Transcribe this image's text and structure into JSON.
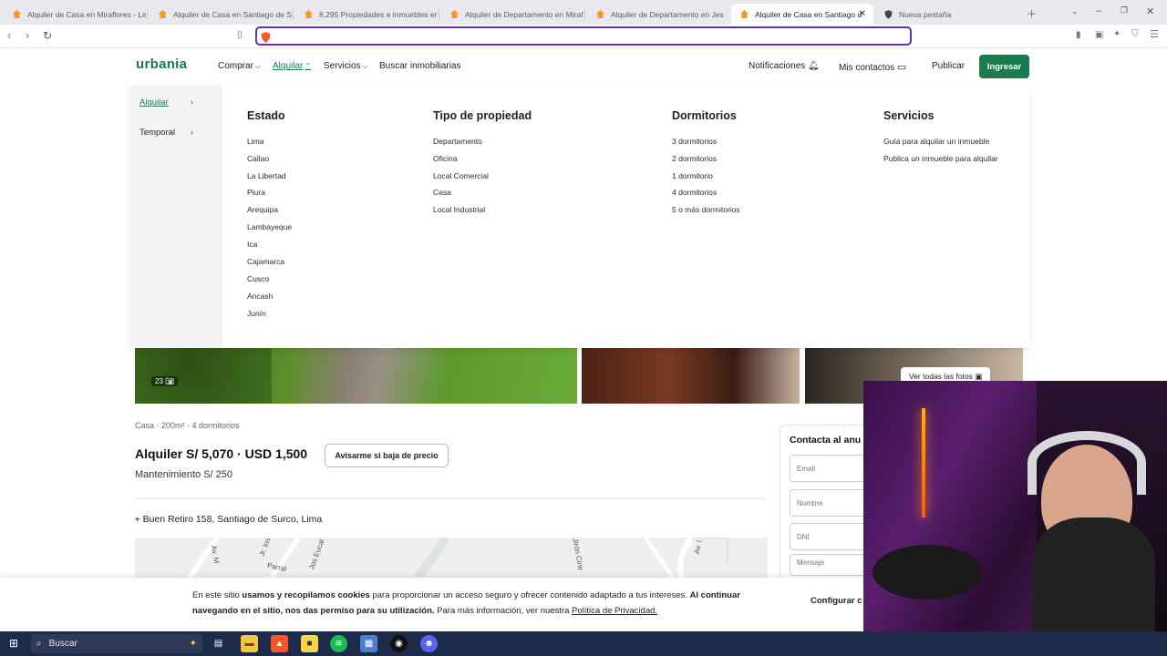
{
  "browser": {
    "tabs": [
      {
        "title": "Alquiler de Casa en Miraflores - Lim",
        "active": false
      },
      {
        "title": "Alquiler de Casa en Santiago de Sur",
        "active": false
      },
      {
        "title": "8.295 Propiedades e inmuebles en a",
        "active": false
      },
      {
        "title": "Alquiler de Departamento en Miraf",
        "active": false
      },
      {
        "title": "Alquiler de Departamento en Jesús",
        "active": false
      },
      {
        "title": "Alquiler de Casa en Santiago d",
        "active": true
      },
      {
        "title": "Nueva pestaña",
        "active": false
      }
    ],
    "url": ""
  },
  "header": {
    "logo": "urbania",
    "nav": [
      "Comprar",
      "Alquilar",
      "Servicios",
      "Buscar inmobiliarias"
    ],
    "right": [
      "Notificaciones",
      "Mis contactos",
      "Publicar"
    ],
    "login": "Ingresar"
  },
  "menu": {
    "side": [
      "Alquilar",
      "Temporal"
    ],
    "columns": [
      {
        "title": "Estado",
        "links": [
          "Lima",
          "Callao",
          "La Libertad",
          "Piura",
          "Arequipa",
          "Lambayeque",
          "Ica",
          "Cajamarca",
          "Cusco",
          "Ancash",
          "Junín"
        ]
      },
      {
        "title": "Tipo de propiedad",
        "links": [
          "Departamento",
          "Oficina",
          "Local Comercial",
          "Casa",
          "Local Industrial"
        ]
      },
      {
        "title": "Dormitorios",
        "links": [
          "3 dormitorios",
          "2 dormitorios",
          "1 dormitorio",
          "4 dormitorios",
          "5 o más dormitorios"
        ]
      },
      {
        "title": "Servicios",
        "links": [
          "Guía para alquilar un inmueble",
          "Publica un inmueble para alquilar"
        ]
      }
    ]
  },
  "listing": {
    "photo_count": "23",
    "see_all_photos": "Ver todas las fotos",
    "meta": "Casa · 200m² · 4 dormitorios",
    "price": "Alquiler S/ 5,070 · USD 1,500",
    "price_alert_button": "Avisarme si baja de precio",
    "maintenance": "Mantenimiento S/ 250",
    "address": "Buen Retiro 158, Santiago de Surco, Lima",
    "map_labels": [
      "Av. M",
      "Jr. los",
      "Parral",
      "Jos Eucal",
      "Jirón Cine",
      "Av. I"
    ]
  },
  "contact": {
    "title": "Contacta al anu",
    "fields": [
      "Email",
      "Nombre",
      "DNI",
      "Mensaje"
    ]
  },
  "cookie": {
    "part1": "En este sitio ",
    "bold1": "usamos y recopilamos cookies",
    "part2": " para proporcionar un acceso seguro y ofrecer contenido adaptado a tus intereses. ",
    "bold2": "Al continuar navegando en el sitio, nos das permiso para su utilización.",
    "part3": " Para más información, ver nuestra ",
    "link": "Política de Privacidad.",
    "config": "Configurar c"
  },
  "taskbar": {
    "search_placeholder": "Buscar"
  },
  "colors": {
    "brand": "#1c7a4d",
    "url_focus": "#5e35b1",
    "taskbar": "#1d2b4a"
  }
}
